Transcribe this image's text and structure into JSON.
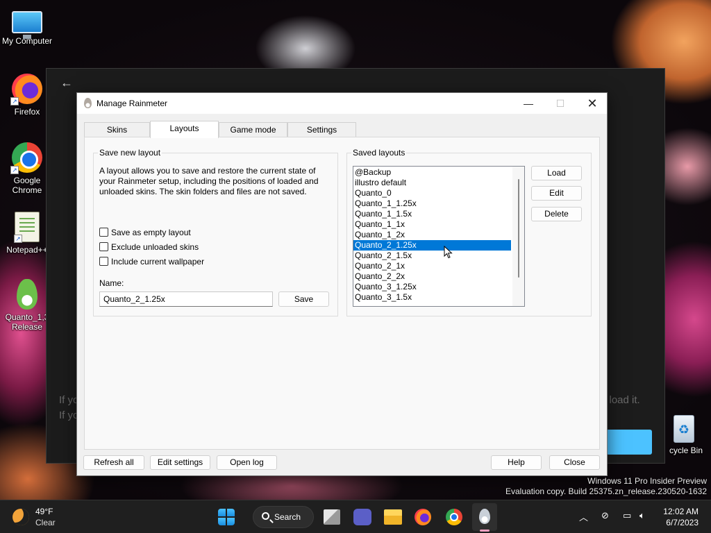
{
  "desktop": {
    "icons": [
      {
        "label": "My Computer",
        "icon": "monitor-icon"
      },
      {
        "label": "Firefox",
        "icon": "firefox-icon"
      },
      {
        "label": "Google Chrome",
        "icon": "chrome-icon"
      },
      {
        "label": "Notepad++",
        "icon": "notepad-icon"
      },
      {
        "label": "Quanto_1,3 Release",
        "icon": "rainmeter-drop-icon"
      },
      {
        "label": "cycle Bin",
        "icon": "recycle-bin-icon"
      }
    ],
    "background_window": {
      "text_left_1": "If yo",
      "text_left_2": "If yo",
      "text_right": "n load it."
    }
  },
  "dialog": {
    "title": "Manage Rainmeter",
    "tabs": [
      {
        "label": "Skins",
        "active": false
      },
      {
        "label": "Layouts",
        "active": true
      },
      {
        "label": "Game mode",
        "active": false
      },
      {
        "label": "Settings",
        "active": false
      }
    ],
    "save_new_layout": {
      "group_title": "Save new layout",
      "description": "A layout allows you to save and restore the current state of your Rainmeter setup, including the positions of loaded and unloaded skins. The skin folders and files are not saved.",
      "checkboxes": [
        {
          "label": "Save as empty layout",
          "checked": false
        },
        {
          "label": "Exclude unloaded skins",
          "checked": false
        },
        {
          "label": "Include current wallpaper",
          "checked": false
        }
      ],
      "name_label": "Name:",
      "name_value": "Quanto_2_1.25x",
      "save_button": "Save"
    },
    "saved_layouts": {
      "group_title": "Saved layouts",
      "items": [
        "@Backup",
        "illustro default",
        "Quanto_0",
        "Quanto_1_1.25x",
        "Quanto_1_1.5x",
        "Quanto_1_1x",
        "Quanto_1_2x",
        "Quanto_2_1.25x",
        "Quanto_2_1.5x",
        "Quanto_2_1x",
        "Quanto_2_2x",
        "Quanto_3_1.25x",
        "Quanto_3_1.5x"
      ],
      "selected": "Quanto_2_1.25x",
      "load_button": "Load",
      "edit_button": "Edit",
      "delete_button": "Delete"
    },
    "footer": {
      "refresh_all": "Refresh all",
      "edit_settings": "Edit settings",
      "open_log": "Open log",
      "help": "Help",
      "close": "Close"
    }
  },
  "watermark": {
    "line1": "Windows 11 Pro Insider Preview",
    "line2": "Evaluation copy. Build 25375.zn_release.230520-1632"
  },
  "taskbar": {
    "weather_temp": "49°F",
    "weather_desc": "Clear",
    "search_label": "Search",
    "time": "12:02 AM",
    "date": "6/7/2023",
    "accent": "#4cc2ff"
  }
}
